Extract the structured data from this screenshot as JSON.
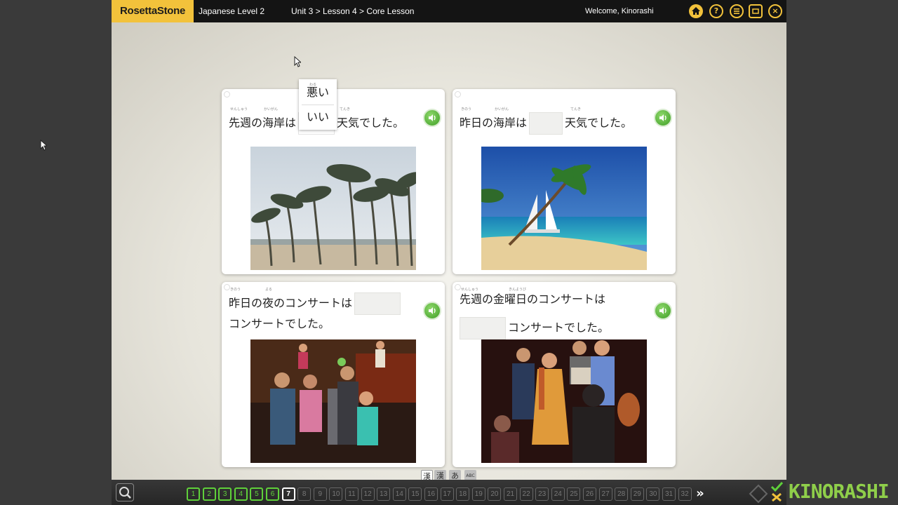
{
  "header": {
    "logo": "RosettaStone",
    "course": "Japanese Level 2",
    "breadcrumb": "Unit 3 > Lesson 4 > Core Lesson",
    "welcome": "Welcome, Kinorashi",
    "icons": [
      "home-icon",
      "help-icon",
      "menu-icon",
      "window-icon",
      "close-icon"
    ]
  },
  "cards": [
    {
      "sentence_before": "先週の海岸は",
      "blank_value": "いい",
      "sentence_after": "天気でした。",
      "ruby": [
        "せんしゅう",
        "かいがん",
        "てんき"
      ],
      "image": "palm trees bending in a storm on a beach"
    },
    {
      "sentence_before": "昨日の海岸は",
      "blank_value": "",
      "sentence_after": "天気でした。",
      "ruby": [
        "きのう",
        "かいがん",
        "てんき"
      ],
      "image": "sunny tropical beach with sailboat and palm tree"
    },
    {
      "sentence_before": "昨日の夜のコンサートは",
      "blank_value": "",
      "sentence_after": "コンサートでした。",
      "ruby": [
        "きのう",
        "よる"
      ],
      "image": "people dancing at a rock concert"
    },
    {
      "sentence_before": "先週の金曜日のコンサートは",
      "blank_value": "",
      "sentence_after": "コンサートでした。",
      "ruby": [
        "せんしゅう",
        "きんようび"
      ],
      "image": "musicians with accordion and guitar at a concert"
    }
  ],
  "dropdown": {
    "options": [
      "悪い",
      "いい"
    ],
    "option_ruby": "わる"
  },
  "script_modes": [
    "漢",
    "漢",
    "あ",
    "ABC"
  ],
  "pagination": {
    "pages": [
      "1",
      "2",
      "3",
      "4",
      "5",
      "6",
      "7",
      "8",
      "9",
      "10",
      "11",
      "12",
      "13",
      "14",
      "15",
      "16",
      "17",
      "18",
      "19",
      "20",
      "21",
      "22",
      "23",
      "24",
      "25",
      "26",
      "27",
      "28",
      "29",
      "30",
      "31",
      "32"
    ],
    "completed": 6,
    "current": "7",
    "next_label": "»"
  },
  "watermark": "KINORASHI",
  "colors": {
    "brand": "#f2c23b",
    "done": "#5fd03a",
    "speaker": "#3e9e25"
  }
}
